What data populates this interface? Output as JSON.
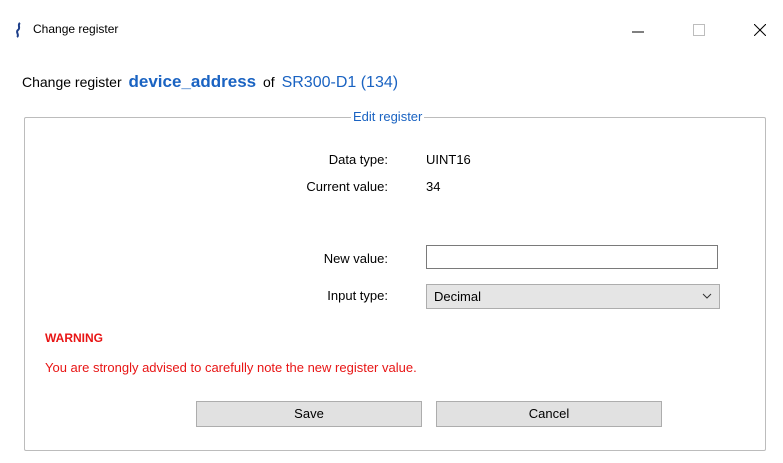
{
  "window": {
    "title": "Change register",
    "icon": "app-logo-icon",
    "controls": [
      "minimize-icon",
      "maximize-icon",
      "close-icon"
    ]
  },
  "header": {
    "prefix": "Change register",
    "register_name": "device_address",
    "connector": "of",
    "device": "SR300-D1 (134)"
  },
  "group": {
    "legend": "Edit register",
    "data_type_label": "Data type:",
    "data_type_value": "UINT16",
    "current_value_label": "Current value:",
    "current_value": "34",
    "new_value_label": "New value:",
    "new_value": "",
    "input_type_label": "Input type:",
    "input_type_selected": "Decimal",
    "warning_title": "WARNING",
    "warning_text": "You are strongly advised to carefully note the new register value.",
    "save_label": "Save",
    "cancel_label": "Cancel"
  },
  "colors": {
    "accent": "#1a63c2",
    "warning": "#e81515",
    "button_bg": "#e1e1e1"
  }
}
